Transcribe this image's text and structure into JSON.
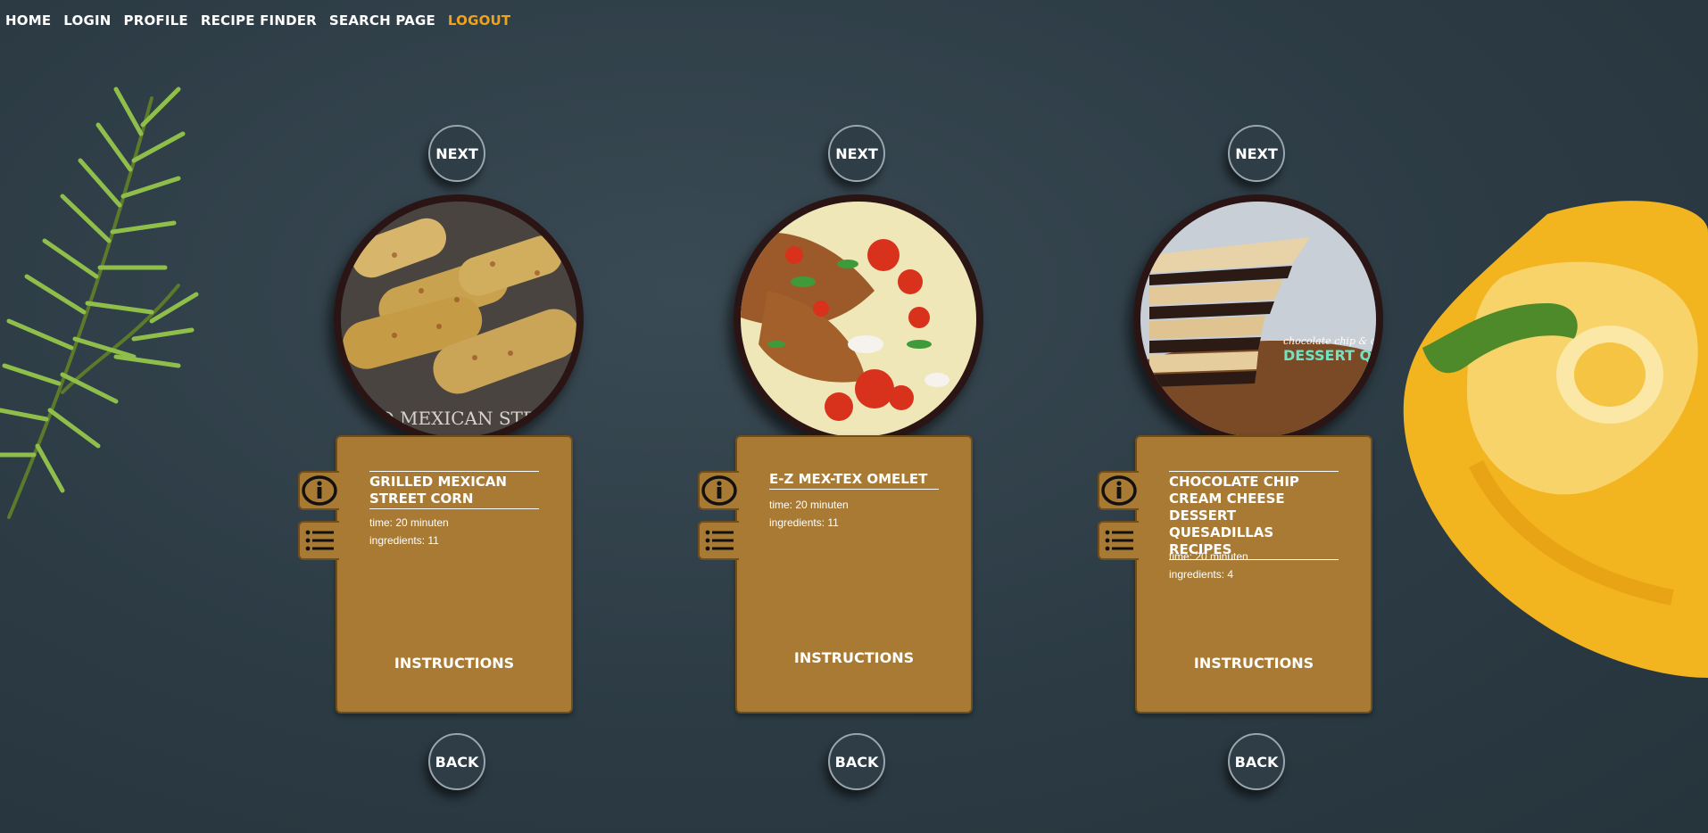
{
  "nav": {
    "items": [
      "HOME",
      "LOGIN",
      "PROFILE",
      "RECIPE FINDER",
      "SEARCH PAGE"
    ],
    "logout": "LOGOUT",
    "accent_color": "#f0a21b"
  },
  "recipes": [
    {
      "next_label": "NEXT",
      "back_label": "BACK",
      "title": "GRILLED MEXICAN STREET CORN",
      "time": "time: 20 minuten",
      "ingredients": "ingredients: 11",
      "instructions_label": "INSTRUCTIONS",
      "image_text": "LLED MEXICAN STREET"
    },
    {
      "next_label": "NEXT",
      "back_label": "BACK",
      "title": "E-Z MEX-TEX OMELET",
      "time": "time: 20 minuten",
      "ingredients": "ingredients: 11",
      "instructions_label": "INSTRUCTIONS"
    },
    {
      "next_label": "NEXT",
      "back_label": "BACK",
      "title": "CHOCOLATE CHIP CREAM CHEESE DESSERT QUESADILLAS RECIPES",
      "time": "time: 20 minuten",
      "ingredients": "ingredients: 4",
      "instructions_label": "INSTRUCTIONS",
      "image_text_1": "chocolate chip & cr",
      "image_text_2": "DESSERT QUES"
    }
  ],
  "icons": {
    "info": "info-icon",
    "list": "list-icon"
  },
  "colors": {
    "card": "#a87a33",
    "background": "#2e3d46",
    "ring": "#2a1414"
  }
}
